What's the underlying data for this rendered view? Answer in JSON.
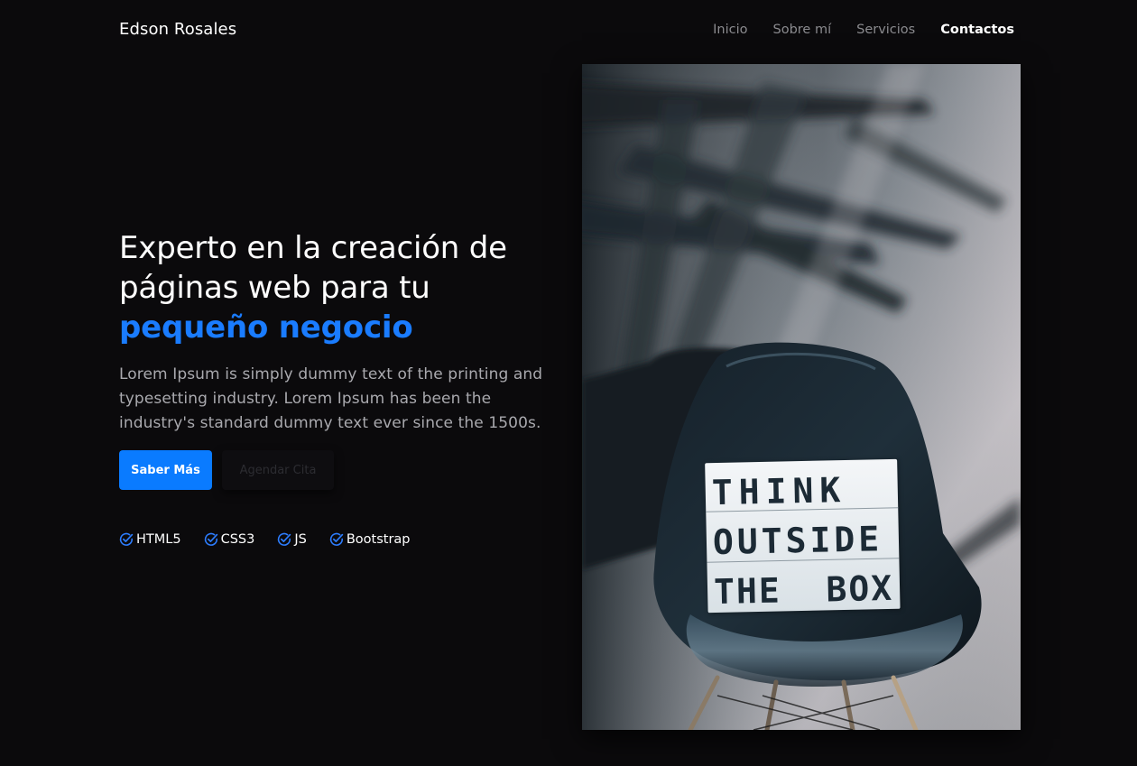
{
  "navbar": {
    "brand": "Edson Rosales",
    "links": [
      {
        "label": "Inicio"
      },
      {
        "label": "Sobre mí"
      },
      {
        "label": "Servicios"
      },
      {
        "label": "Contactos"
      }
    ]
  },
  "hero": {
    "title_line1": "Experto en la creación de",
    "title_line2": "páginas web para tu",
    "title_highlight": "pequeño negocio",
    "description": "Lorem Ipsum is simply dummy text of the printing and typesetting industry. Lorem Ipsum has been the industry's standard dummy text ever since the 1500s.",
    "primary_button": "Saber Más",
    "secondary_button": "Agendar Cita",
    "tags": [
      "HTML5",
      "CSS3",
      "JS",
      "Bootstrap"
    ]
  },
  "photo": {
    "sign_lines": [
      "THINK",
      "OUTSIDE",
      "THE  BOX"
    ]
  },
  "colors": {
    "background": "#0b0a0c",
    "accent": "#0a7bff",
    "text": "#ffffff",
    "muted": "#a9a9ae",
    "check_icon": "#2d7dff"
  }
}
